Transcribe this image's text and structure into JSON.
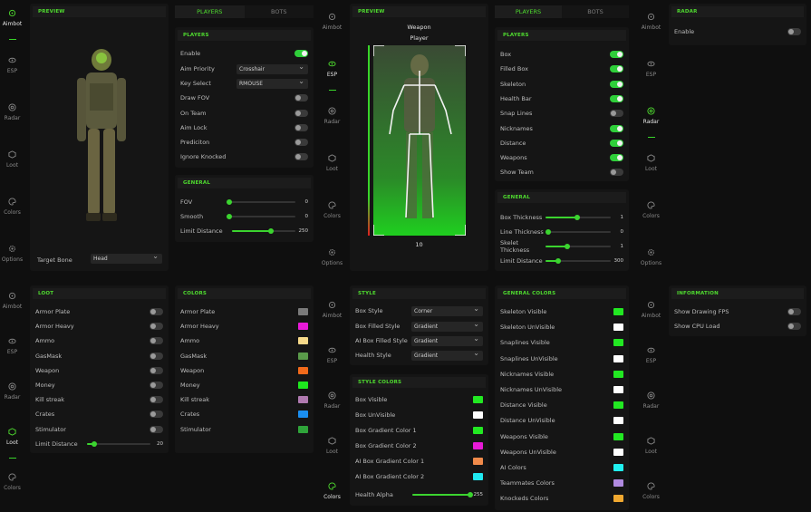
{
  "nav": [
    "Aimbot",
    "ESP",
    "Radar",
    "Loot",
    "Colors",
    "Options"
  ],
  "tabs": {
    "players": "PLAYERS",
    "bots": "BOTS"
  },
  "p1": {
    "preview": "PREVIEW",
    "target_bone_label": "Target Bone",
    "target_bone_value": "Head",
    "players_title": "PLAYERS",
    "enable": "Enable",
    "aim_priority": "Aim Priority",
    "aim_priority_value": "Crosshair",
    "key_select": "Key Select",
    "key_select_value": "RMOUSE",
    "draw_fov": "Draw FOV",
    "on_team": "On Team",
    "aim_lock": "Aim Lock",
    "prediction": "Prediciton",
    "ignore_knocked": "Ignore Knocked",
    "general_title": "GENERAL",
    "fov": "FOV",
    "fov_value": "0",
    "fov_frac": 0.0,
    "smooth": "Smooth",
    "smooth_value": "0",
    "smooth_frac": 0.0,
    "limit_distance": "Limit Distance",
    "limit_value": "250",
    "limit_frac": 0.62
  },
  "p2": {
    "preview": "PREVIEW",
    "weapon": "Weapon",
    "player": "Player",
    "distance": "10",
    "players_title": "PLAYERS",
    "items": [
      {
        "label": "Box",
        "on": true
      },
      {
        "label": "Filled Box",
        "on": true
      },
      {
        "label": "Skeleton",
        "on": true
      },
      {
        "label": "Health Bar",
        "on": true
      },
      {
        "label": "Snap Lines",
        "on": false
      },
      {
        "label": "Nicknames",
        "on": true
      },
      {
        "label": "Distance",
        "on": true
      },
      {
        "label": "Weapons",
        "on": true
      },
      {
        "label": "Show Team",
        "on": false
      }
    ],
    "general_title": "GENERAL",
    "box_thickness": "Box Thickness",
    "box_thickness_value": "1",
    "box_thickness_frac": 0.48,
    "line_thickness": "Line Thickness",
    "line_thickness_value": "0",
    "line_thickness_frac": 0.0,
    "skelet_thickness": "Skelet Thickness",
    "skelet_thickness_value": "1",
    "skelet_thickness_frac": 0.34,
    "limit_distance": "Limit Distance",
    "limit_distance_value": "300",
    "limit_distance_frac": 0.2
  },
  "p3": {
    "radar_title": "RADAR",
    "enable": "Enable",
    "info_title": "INFORMATION",
    "show_fps": "Show Drawing FPS",
    "show_cpu": "Show CPU Load"
  },
  "loot": {
    "title": "LOOT",
    "items": [
      "Armor Plate",
      "Armor Heavy",
      "Ammo",
      "GasMask",
      "Weapon",
      "Money",
      "Kill streak",
      "Crates",
      "Stimulator"
    ],
    "limit_label": "Limit Distance",
    "limit_value": "20",
    "limit_frac": 0.12
  },
  "colors": {
    "title": "COLORS",
    "items": [
      {
        "label": "Armor Plate",
        "color": "#7a7a7a"
      },
      {
        "label": "Armor Heavy",
        "color": "#e81ad8"
      },
      {
        "label": "Ammo",
        "color": "#f7d98a"
      },
      {
        "label": "GasMask",
        "color": "#5a9a4a"
      },
      {
        "label": "Weapon",
        "color": "#f26a1b"
      },
      {
        "label": "Money",
        "color": "#1ee81e"
      },
      {
        "label": "Kill streak",
        "color": "#b07ab0"
      },
      {
        "label": "Crates",
        "color": "#1a8ef0"
      },
      {
        "label": "Stimulator",
        "color": "#2fa43a"
      }
    ]
  },
  "style": {
    "title": "STYLE",
    "box_style": "Box Style",
    "box_style_value": "Corner",
    "box_filled": "Box Filled Style",
    "box_filled_value": "Gradient",
    "ai_filled": "AI Box Filled Style",
    "ai_filled_value": "Gradient",
    "health": "Health Style",
    "health_value": "Gradient"
  },
  "style_colors": {
    "title": "STYLE COLORS",
    "items": [
      {
        "label": "Box Visible",
        "color": "#22e822"
      },
      {
        "label": "Box UnVisible",
        "color": "#ffffff"
      },
      {
        "label": "Box Gradient Color 1",
        "color": "#22e822"
      },
      {
        "label": "Box Gradient Color 2",
        "color": "#e81ad8"
      },
      {
        "label": "AI Box Gradient Color 1",
        "color": "#f08a4a"
      },
      {
        "label": "AI Box Gradient Color 2",
        "color": "#20e8f0"
      }
    ],
    "health_alpha": "Health Alpha",
    "health_alpha_value": "255",
    "health_alpha_frac": 1.0
  },
  "general_colors": {
    "title": "GENERAL COLORS",
    "items": [
      {
        "label": "Skeleton Visible",
        "color": "#22e822"
      },
      {
        "label": "Skeleton UnVisible",
        "color": "#ffffff"
      },
      {
        "label": "Snaplines Visible",
        "color": "#22e822"
      },
      {
        "label": "Snaplines UnVisible",
        "color": "#ffffff"
      },
      {
        "label": "Nicknames Visible",
        "color": "#22e822"
      },
      {
        "label": "Nicknames UnVisible",
        "color": "#ffffff"
      },
      {
        "label": "Distance Visible",
        "color": "#22e822"
      },
      {
        "label": "Distance UnVisible",
        "color": "#ffffff"
      },
      {
        "label": "Weapons Visible",
        "color": "#22e822"
      },
      {
        "label": "Weapons UnVisible",
        "color": "#ffffff"
      },
      {
        "label": "AI Colors",
        "color": "#20f0f0"
      },
      {
        "label": "Teammates Colors",
        "color": "#b08ae0"
      },
      {
        "label": "Knockeds Colors",
        "color": "#f0a830"
      }
    ]
  }
}
